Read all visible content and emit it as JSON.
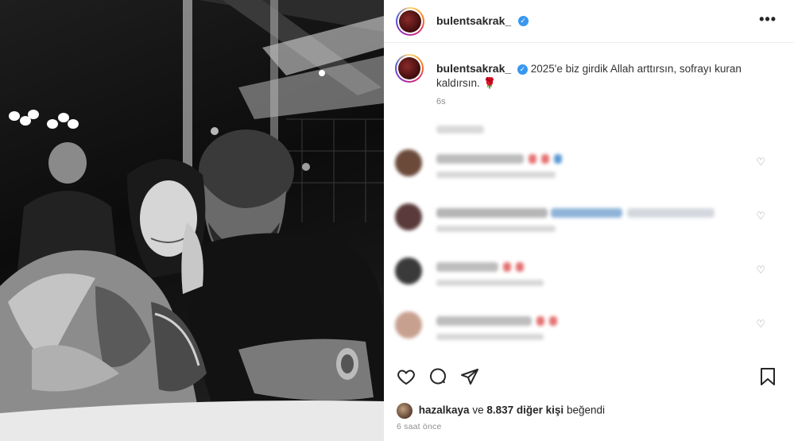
{
  "post": {
    "username": "bulentsakrak_",
    "caption_username": "bulentsakrak_",
    "caption_text": "2025'e biz girdik Allah arttırsın, sofrayı kuran kaldırsın.",
    "caption_emoji": "🌹",
    "caption_time": "6s",
    "more_icon_glyph": "•••",
    "verified_glyph": "✓"
  },
  "comments": [
    {
      "avatar_color": "#6b4a3a",
      "line_color": "#bdbdbd",
      "emoji_colors": [
        "#e57373",
        "#e57373",
        "#5c9bd6"
      ]
    },
    {
      "avatar_color": "#5a3a3a",
      "line_color": "#a9b8c8",
      "emoji_colors": [
        "#5c9bd6",
        "#5c9bd6",
        "#5c9bd6"
      ]
    },
    {
      "avatar_color": "#3a3a3a",
      "line_color": "#bdbdbd",
      "emoji_colors": [
        "#e57373",
        "#e57373"
      ]
    },
    {
      "avatar_color": "#c8a090",
      "line_color": "#bdbdbd",
      "emoji_colors": [
        "#e57373",
        "#e57373"
      ]
    }
  ],
  "likes": {
    "first_liker": "hazalkaya",
    "connector": "ve",
    "others": "8.837 diğer kişi",
    "suffix": "beğendi"
  },
  "timestamp": "6 saat önce",
  "icons": {
    "like": "heart-icon",
    "comment": "comment-icon",
    "share": "share-icon",
    "save": "bookmark-icon"
  }
}
